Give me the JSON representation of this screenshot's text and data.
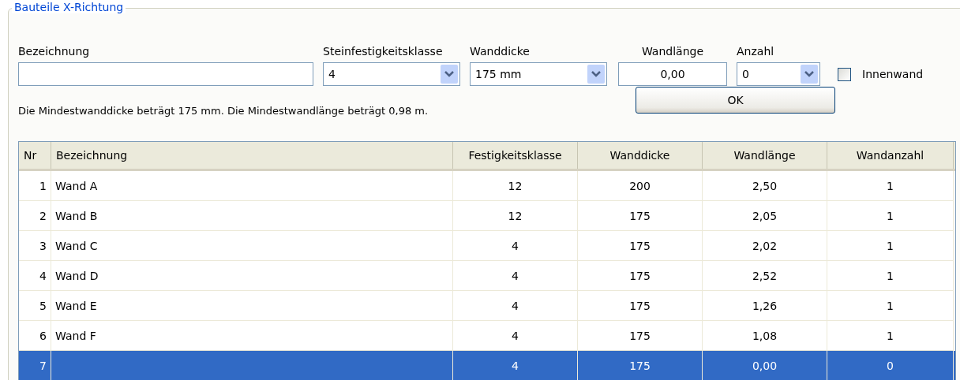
{
  "group": {
    "title": "Bauteile X-Richtung"
  },
  "form": {
    "fields": [
      {
        "kind": "text",
        "label": "Bezeichnung"
      },
      {
        "kind": "combo",
        "label": "Steinfestigkeitsklasse",
        "value": "4"
      },
      {
        "kind": "combo",
        "label": "Wanddicke",
        "value": "175 mm"
      },
      {
        "kind": "number",
        "label": "Wandlänge",
        "value": "0,00"
      },
      {
        "kind": "combo",
        "label": "Anzahl",
        "value": "0"
      }
    ],
    "checkbox": {
      "label": "Innenwand",
      "checked": false
    },
    "ok_button": "OK",
    "message": "Die Mindestwanddicke beträgt 175 mm. Die Mindestwandlänge beträgt 0,98 m."
  },
  "table": {
    "columns": [
      "Nr",
      "Bezeichnung",
      "Festigkeitsklasse",
      "Wanddicke",
      "Wandlänge",
      "Wandanzahl"
    ],
    "rows": [
      {
        "cells": [
          "1",
          "Wand A",
          "12",
          "200",
          "2,50",
          "1"
        ],
        "selected": false
      },
      {
        "cells": [
          "2",
          "Wand B",
          "12",
          "175",
          "2,05",
          "1"
        ],
        "selected": false
      },
      {
        "cells": [
          "3",
          "Wand C",
          "4",
          "175",
          "2,02",
          "1"
        ],
        "selected": false
      },
      {
        "cells": [
          "4",
          "Wand D",
          "4",
          "175",
          "2,52",
          "1"
        ],
        "selected": false
      },
      {
        "cells": [
          "5",
          "Wand E",
          "4",
          "175",
          "1,26",
          "1"
        ],
        "selected": false
      },
      {
        "cells": [
          "6",
          "Wand F",
          "4",
          "175",
          "1,08",
          "1"
        ],
        "selected": false
      },
      {
        "cells": [
          "7",
          "",
          "4",
          "175",
          "0,00",
          "0"
        ],
        "selected": true
      }
    ]
  }
}
